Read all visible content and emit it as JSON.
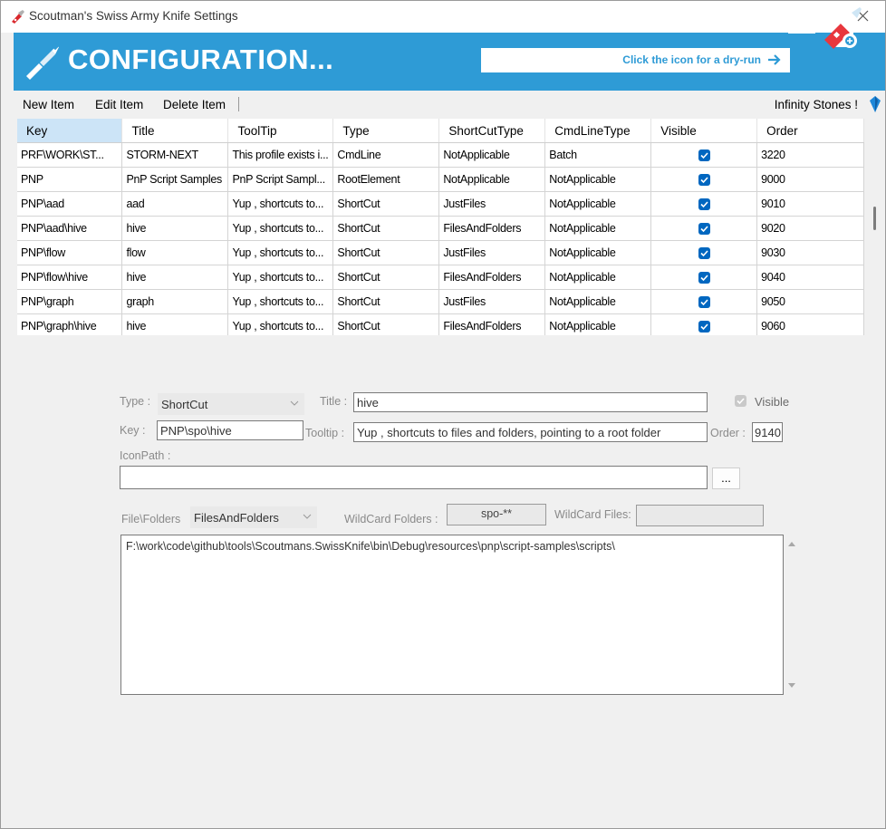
{
  "window": {
    "title": "Scoutman's Swiss Army Knife Settings"
  },
  "banner": {
    "title": "CONFIGURATION...",
    "dryrun_hint": "Click the icon for a dry-run",
    "accent_color": "#2e9bd6"
  },
  "menu": {
    "new_item": "New Item",
    "edit_item": "Edit Item",
    "delete_item": "Delete Item",
    "infinity_stones": "Infinity Stones !"
  },
  "grid": {
    "columns": [
      "Key",
      "Title",
      "ToolTip",
      "Type",
      "ShortCutType",
      "CmdLineType",
      "Visible",
      "Order"
    ],
    "rows": [
      {
        "key": "PRF\\WORK\\ST...",
        "title": "STORM-NEXT",
        "tooltip": "This profile exists i...",
        "type": "CmdLine",
        "shortcut_type": "NotApplicable",
        "cmdline_type": "Batch",
        "visible": true,
        "order": "3220"
      },
      {
        "key": "PNP",
        "title": "PnP Script Samples",
        "tooltip": "PnP Script Sampl...",
        "type": "RootElement",
        "shortcut_type": "NotApplicable",
        "cmdline_type": "NotApplicable",
        "visible": true,
        "order": "9000"
      },
      {
        "key": "PNP\\aad",
        "title": "aad",
        "tooltip": "Yup , shortcuts to...",
        "type": "ShortCut",
        "shortcut_type": "JustFiles",
        "cmdline_type": "NotApplicable",
        "visible": true,
        "order": "9010"
      },
      {
        "key": "PNP\\aad\\hive",
        "title": "hive",
        "tooltip": "Yup , shortcuts to...",
        "type": "ShortCut",
        "shortcut_type": "FilesAndFolders",
        "cmdline_type": "NotApplicable",
        "visible": true,
        "order": "9020"
      },
      {
        "key": "PNP\\flow",
        "title": "flow",
        "tooltip": "Yup , shortcuts to...",
        "type": "ShortCut",
        "shortcut_type": "JustFiles",
        "cmdline_type": "NotApplicable",
        "visible": true,
        "order": "9030"
      },
      {
        "key": "PNP\\flow\\hive",
        "title": "hive",
        "tooltip": "Yup , shortcuts to...",
        "type": "ShortCut",
        "shortcut_type": "FilesAndFolders",
        "cmdline_type": "NotApplicable",
        "visible": true,
        "order": "9040"
      },
      {
        "key": "PNP\\graph",
        "title": "graph",
        "tooltip": "Yup , shortcuts to...",
        "type": "ShortCut",
        "shortcut_type": "JustFiles",
        "cmdline_type": "NotApplicable",
        "visible": true,
        "order": "9050"
      },
      {
        "key": "PNP\\graph\\hive",
        "title": "hive",
        "tooltip": "Yup , shortcuts to...",
        "type": "ShortCut",
        "shortcut_type": "FilesAndFolders",
        "cmdline_type": "NotApplicable",
        "visible": true,
        "order": "9060"
      }
    ]
  },
  "form": {
    "type_label": "Type :",
    "type_value": "ShortCut",
    "title_label": "Title :",
    "title_value": "hive",
    "visible_label": "Visible",
    "key_label": "Key :",
    "key_value": "PNP\\spo\\hive",
    "tooltip_label": "Tooltip :",
    "tooltip_value": "Yup , shortcuts to files and folders, pointing to a root folder",
    "order_label": "Order :",
    "order_value": "9140",
    "iconpath_label": "IconPath :",
    "iconpath_value": "",
    "browse_label": "...",
    "filefolders_label": "File\\Folders",
    "filefolders_value": "FilesAndFolders",
    "wildcard_folders_label": "WildCard Folders :",
    "wildcard_folders_value": "spo-**",
    "wildcard_files_label": "WildCard Files:",
    "wildcard_files_value": "",
    "path_value": "F:\\work\\code\\github\\tools\\Scoutmans.SwissKnife\\bin\\Debug\\resources\\pnp\\script-samples\\scripts\\"
  }
}
